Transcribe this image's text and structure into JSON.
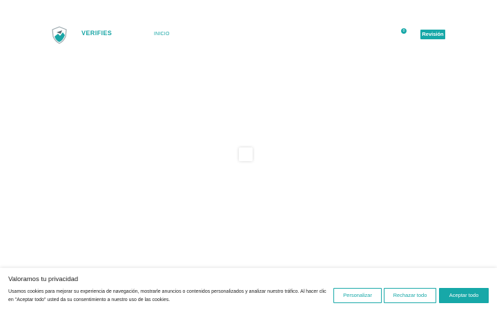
{
  "header": {
    "brand": "VERIFIES",
    "nav": [
      {
        "label": "INICIO"
      }
    ],
    "cart_count": "0",
    "review_button": "Revisión"
  },
  "cookie_banner": {
    "title": "Valoramos tu privacidad",
    "text": "Usamos cookies para mejorar su experiencia de navegación, mostrarle anuncios o contenidos personalizados y analizar nuestro tráfico. Al hacer clic en \"Aceptar todo\" usted da su consentimiento a nuestro uso de las cookies.",
    "buttons": {
      "customize": "Personalizar",
      "reject_all": "Rechazar todo",
      "accept_all": "Aceptar todo"
    }
  },
  "colors": {
    "accent": "#17a8a8",
    "text": "#212121",
    "background": "#ffffff"
  },
  "icons": {
    "logo": "shield-logo-icon"
  }
}
